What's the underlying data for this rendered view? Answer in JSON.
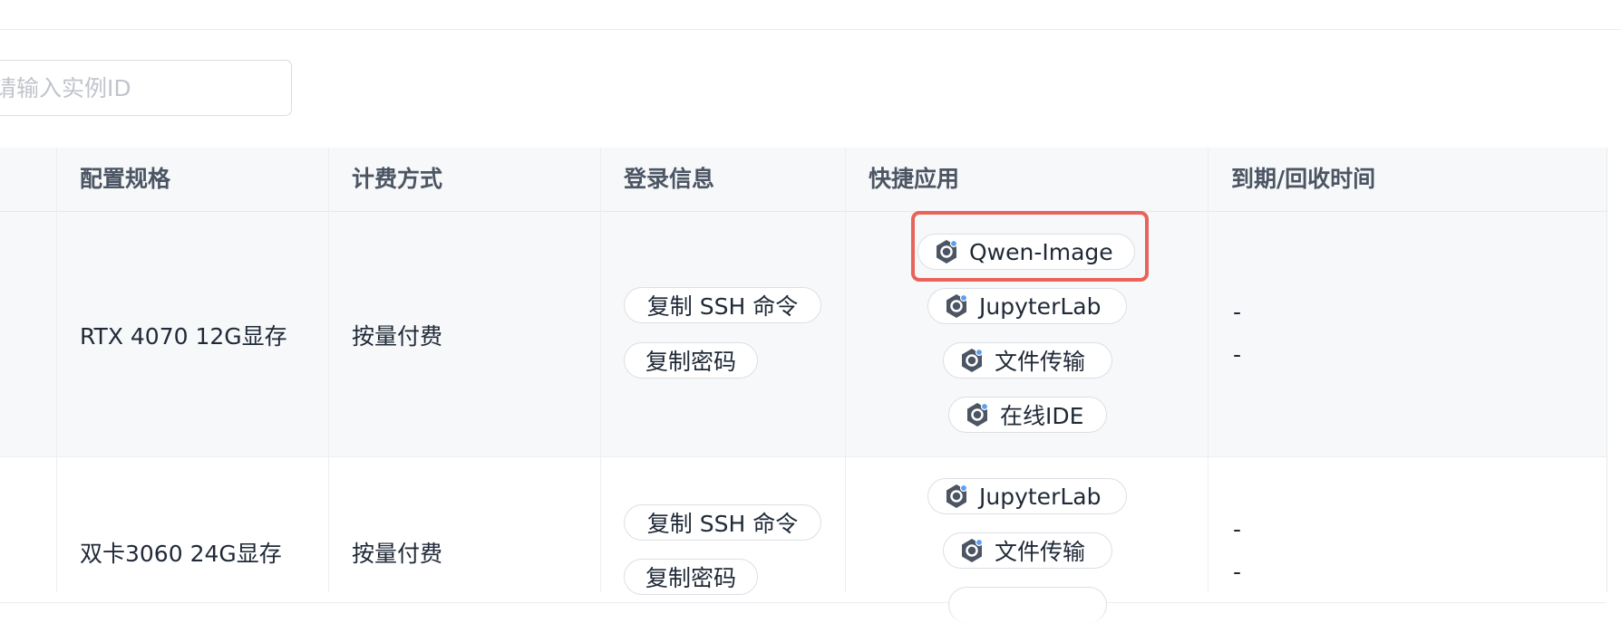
{
  "search": {
    "placeholder": "请输入实例ID",
    "value": ""
  },
  "table": {
    "columns": [
      "配置规格",
      "计费方式",
      "登录信息",
      "快捷应用",
      "到期/回收时间"
    ],
    "rows": [
      {
        "spec": "RTX 4070 12G显存",
        "billing": "按量付费",
        "login_actions": [
          "复制 SSH 命令",
          "复制密码"
        ],
        "apps": [
          "Qwen-Image",
          "JupyterLab",
          "文件传输",
          "在线IDE"
        ],
        "expire": [
          "-",
          "-"
        ],
        "highlighted_app": "Qwen-Image"
      },
      {
        "spec": "双卡3060 24G显存",
        "billing": "按量付费",
        "login_actions": [
          "复制 SSH 命令",
          "复制密码"
        ],
        "apps": [
          "JupyterLab",
          "文件传输"
        ],
        "expire": [
          "-",
          "-"
        ]
      }
    ]
  },
  "colors": {
    "highlight": "#e8635a",
    "header_bg": "#f7f8fa",
    "icon": "#4b5563",
    "icon_dot": "#5aa0f0"
  },
  "icons": {
    "app": "app-hexagon-icon"
  }
}
